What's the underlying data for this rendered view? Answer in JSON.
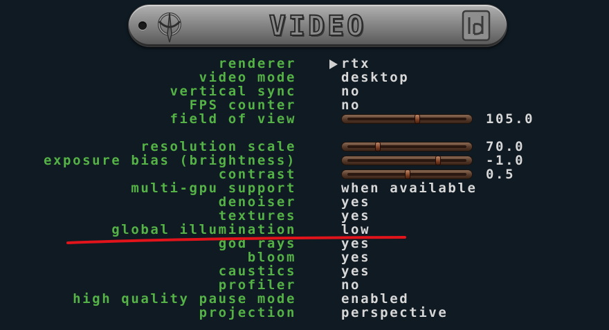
{
  "header": {
    "title": "VIDEO"
  },
  "menu": {
    "rows": [
      {
        "label": "renderer",
        "value": "rtx",
        "type": "choice",
        "selected": true
      },
      {
        "label": "video mode",
        "value": "desktop",
        "type": "choice"
      },
      {
        "label": "vertical sync",
        "value": "no",
        "type": "choice"
      },
      {
        "label": "FPS counter",
        "value": "no",
        "type": "choice"
      },
      {
        "label": "field of view",
        "value": "105.0",
        "type": "slider",
        "level": 0.58
      },
      {
        "label": "",
        "value": "",
        "type": "spacer"
      },
      {
        "label": "resolution scale",
        "value": "70.0",
        "type": "slider",
        "level": 0.25
      },
      {
        "label": "exposure bias (brightness)",
        "value": "-1.0",
        "type": "slider",
        "level": 0.75
      },
      {
        "label": "contrast",
        "value": "0.5",
        "type": "slider",
        "level": 0.5
      },
      {
        "label": "multi-gpu support",
        "value": "when available",
        "type": "choice"
      },
      {
        "label": "denoiser",
        "value": "yes",
        "type": "choice"
      },
      {
        "label": "textures",
        "value": "yes",
        "type": "choice"
      },
      {
        "label": "global illumination",
        "value": "low",
        "type": "choice"
      },
      {
        "label": "god rays",
        "value": "yes",
        "type": "choice"
      },
      {
        "label": "bloom",
        "value": "yes",
        "type": "choice"
      },
      {
        "label": "caustics",
        "value": "yes",
        "type": "choice"
      },
      {
        "label": "profiler",
        "value": "no",
        "type": "choice"
      },
      {
        "label": "high quality pause mode",
        "value": "enabled",
        "type": "choice"
      },
      {
        "label": "projection",
        "value": "perspective",
        "type": "choice"
      }
    ]
  },
  "colors": {
    "label": "#55b246",
    "value": "#d8d8d8",
    "background": "#0f1a22",
    "annotation": "#e0141a"
  },
  "icons": {
    "left_logo": "quake-logo-icon",
    "right_logo": "id-software-logo-icon",
    "cursor": "menu-cursor-icon"
  }
}
